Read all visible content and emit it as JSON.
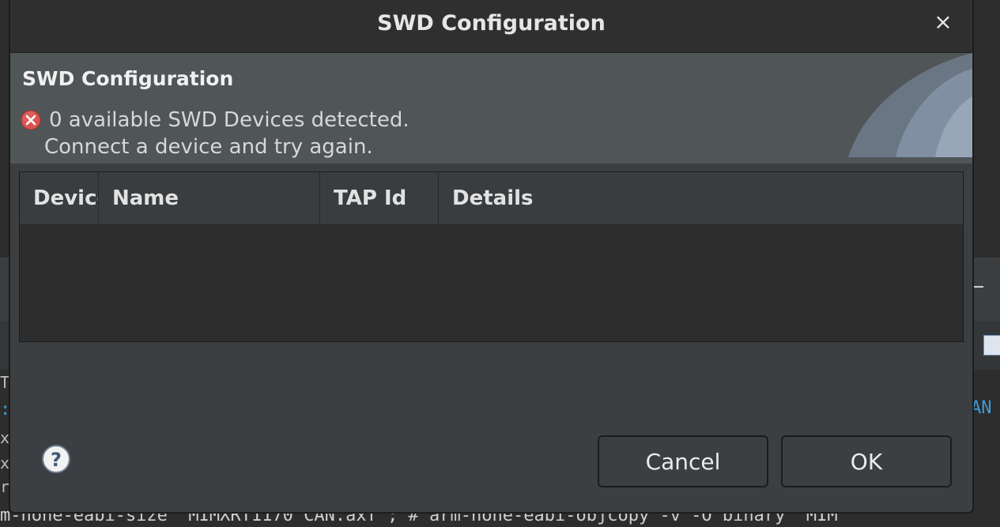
{
  "background": {
    "command_text": "m-none-eabi-size \"MIMXRT1170 CAN.axf\"; # arm-none-eabi-objcopy -v -O binary \"MIM",
    "left_blue_fragment": ":C",
    "right_blue_fragment": "AN",
    "left_fragments": [
      "T",
      "xc",
      "xc",
      "ri"
    ]
  },
  "dialog": {
    "window_title": "SWD Configuration",
    "close_glyph": "×",
    "header_title": "SWD Configuration",
    "message_line1": "0 available SWD Devices detected.",
    "message_line2": "Connect a device and try again.",
    "table": {
      "columns": [
        "Device",
        "Name",
        "TAP Id",
        "Details"
      ],
      "rows": []
    },
    "buttons": {
      "cancel_label": "Cancel",
      "ok_label": "OK"
    },
    "colors": {
      "error_red": "#d9534f",
      "header_band": "#505558",
      "dialog_body": "#3c3f41"
    },
    "icons": {
      "error": "error-icon",
      "help": "help-icon",
      "close": "close-icon"
    }
  }
}
